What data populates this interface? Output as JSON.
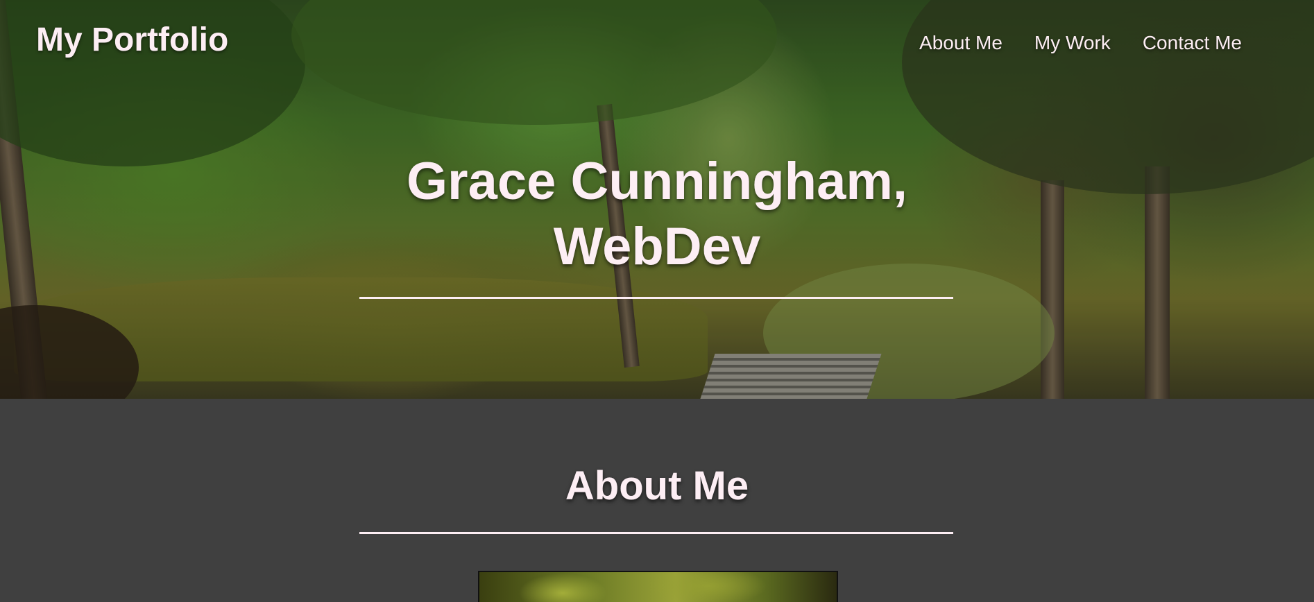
{
  "header": {
    "brand": "My Portfolio",
    "nav": [
      {
        "label": "About Me"
      },
      {
        "label": "My Work"
      },
      {
        "label": "Contact Me"
      }
    ]
  },
  "hero": {
    "title_line1": "Grace Cunningham,",
    "title_line2": "WebDev"
  },
  "about": {
    "title": "About Me"
  },
  "colors": {
    "text": "#fdeef4",
    "section_bg": "#404040"
  }
}
